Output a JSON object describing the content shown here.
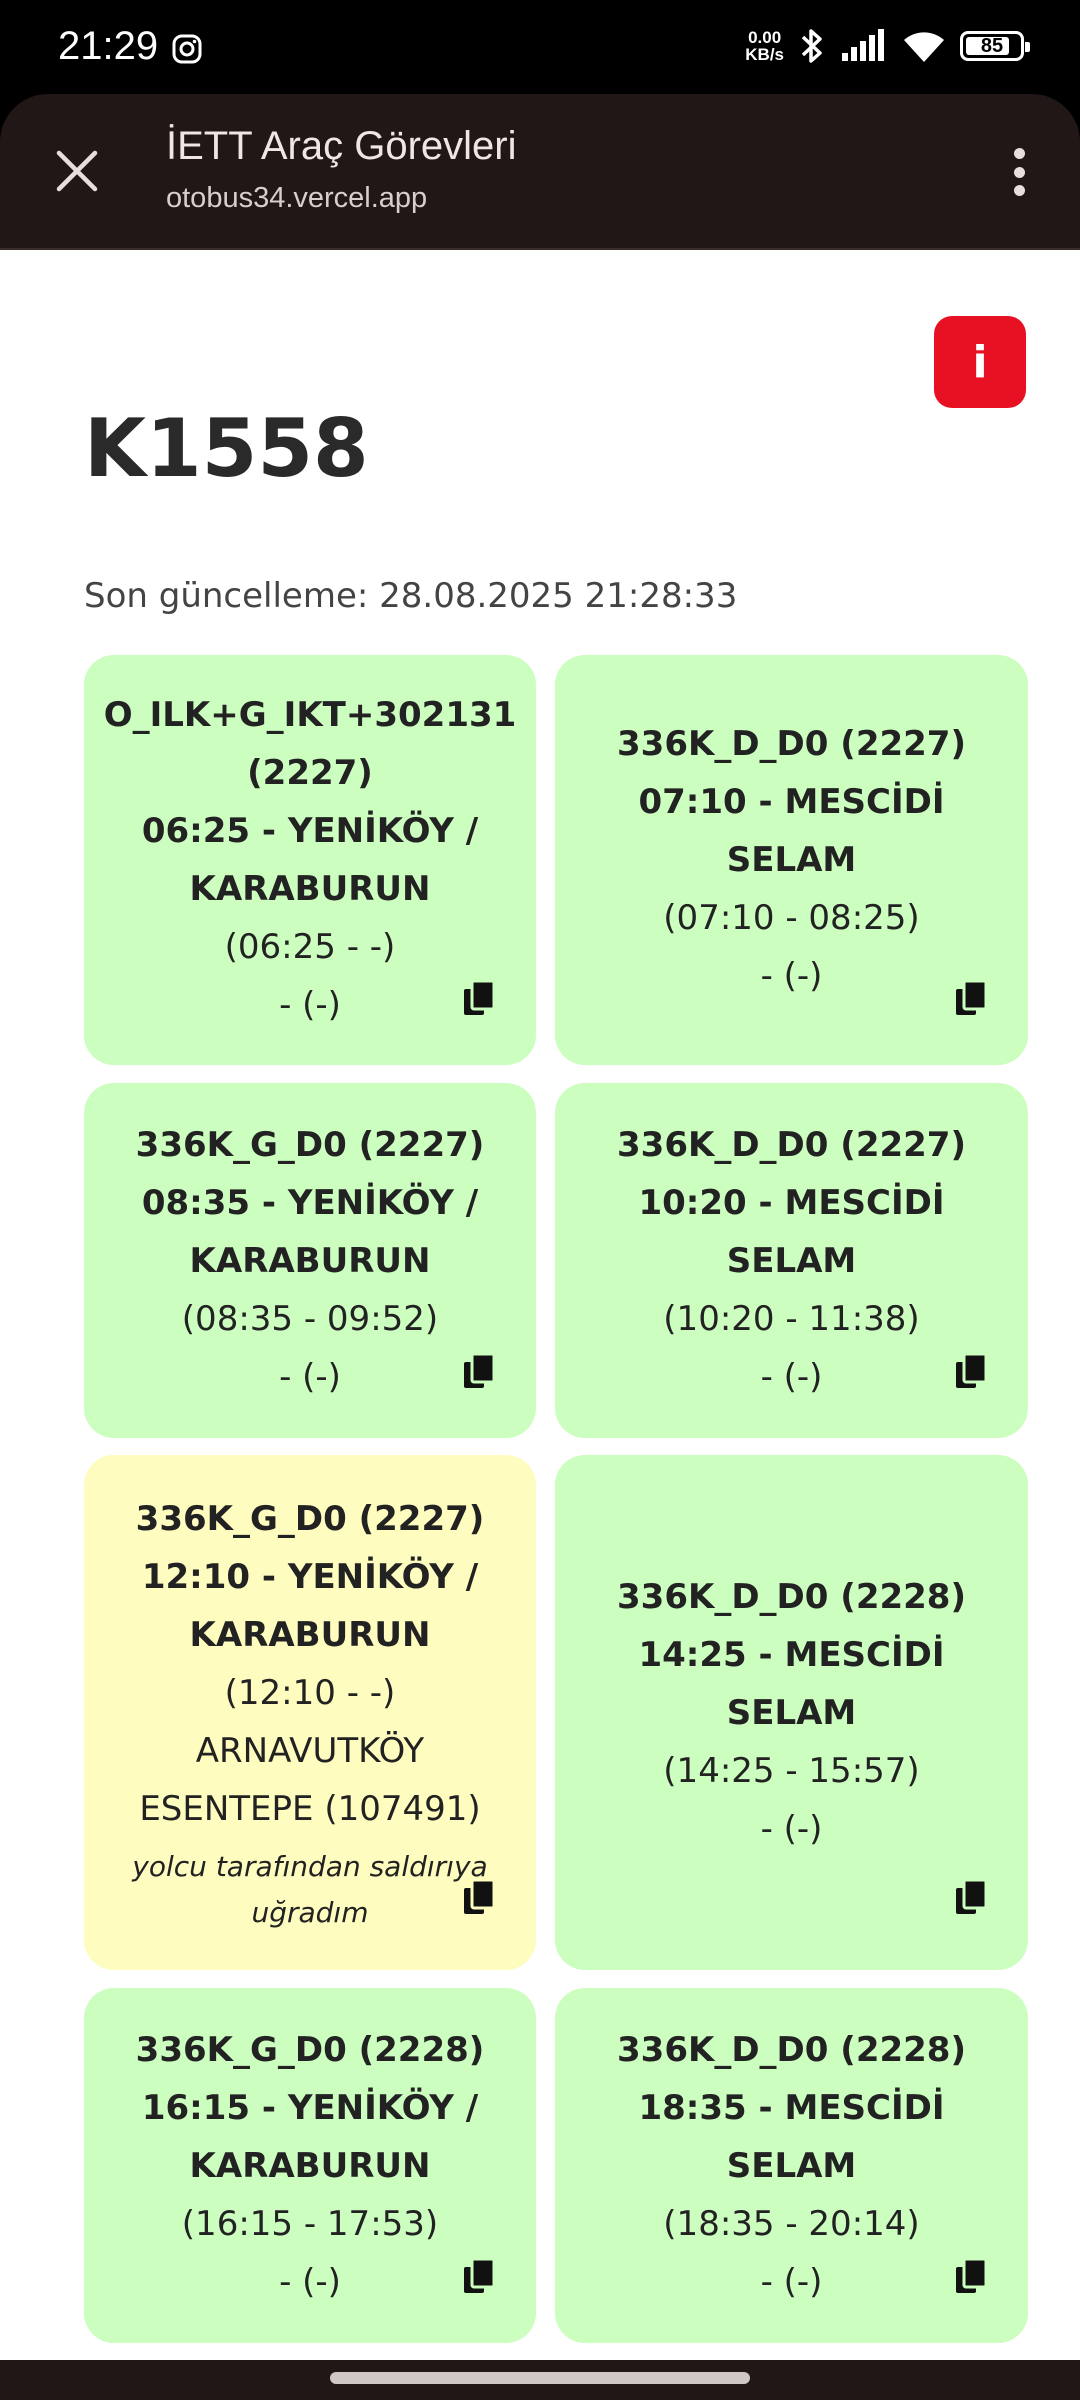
{
  "status_bar": {
    "time": "21:29",
    "net_speed_value": "0.00",
    "net_speed_unit": "KB/s",
    "battery": "85"
  },
  "browser": {
    "title": "İETT Araç Görevleri",
    "url": "otobus34.vercel.app"
  },
  "page": {
    "title": "K1558",
    "last_update": "Son güncelleme: 28.08.2025 21:28:33",
    "info_label": "i"
  },
  "colors": {
    "card_green": "#ccfec0",
    "card_yellow": "#fefcbe",
    "info_red": "#e81123"
  },
  "cards": [
    {
      "line1": "O_ILK+G_IKT+302131",
      "line2": "(2227)",
      "line3": "06:25 - YENİKÖY /",
      "line4": "KARABURUN",
      "times": "(06:25 - -)",
      "detail": "- (-)"
    },
    {
      "line1": "336K_D_D0 (2227)",
      "line2": "07:10 - MESCİDİ",
      "line3": "SELAM",
      "times": "(07:10 - 08:25)",
      "detail": "- (-)"
    },
    {
      "line1": "336K_G_D0 (2227)",
      "line2": "08:35 - YENİKÖY /",
      "line3": "KARABURUN",
      "times": "(08:35 - 09:52)",
      "detail": "- (-)"
    },
    {
      "line1": "336K_D_D0 (2227)",
      "line2": "10:20 - MESCİDİ",
      "line3": "SELAM",
      "times": "(10:20 - 11:38)",
      "detail": "- (-)"
    },
    {
      "line1": "336K_G_D0 (2227)",
      "line2": "12:10 - YENİKÖY /",
      "line3": "KARABURUN",
      "times": "(12:10 - -)",
      "detail1": "ARNAVUTKÖY",
      "detail2": "ESENTEPE (107491)",
      "note1": "yolcu tarafından saldırıya",
      "note2": "uğradım"
    },
    {
      "line1": "336K_D_D0 (2228)",
      "line2": "14:25 - MESCİDİ",
      "line3": "SELAM",
      "times": "(14:25 - 15:57)",
      "detail": "- (-)"
    },
    {
      "line1": "336K_G_D0 (2228)",
      "line2": "16:15 - YENİKÖY /",
      "line3": "KARABURUN",
      "times": "(16:15 - 17:53)",
      "detail": "- (-)"
    },
    {
      "line1": "336K_D_D0 (2228)",
      "line2": "18:35 - MESCİDİ",
      "line3": "SELAM",
      "times": "(18:35 - 20:14)",
      "detail": "- (-)"
    }
  ]
}
